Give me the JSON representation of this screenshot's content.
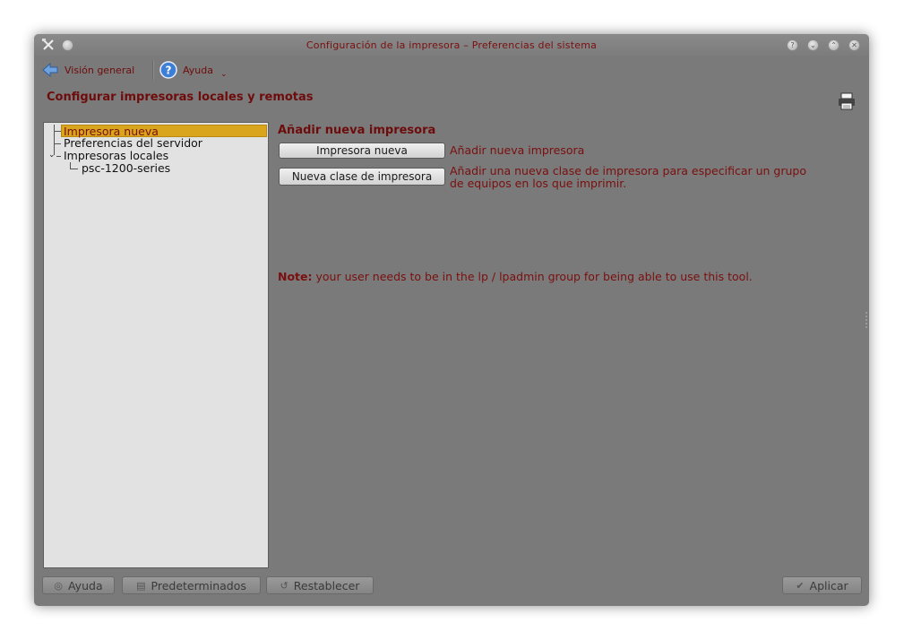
{
  "window": {
    "title": "Configuración de la impresora – Preferencias del sistema",
    "accent_color": "#7a0f0f",
    "background_color": "#7a7a7a"
  },
  "titlebar": {
    "buttons": [
      "help-icon",
      "minimize-icon",
      "maximize-icon",
      "close-icon"
    ]
  },
  "toolbar": {
    "overview_label": "Visión general",
    "help_label": "Ayuda"
  },
  "page": {
    "title": "Configurar impresoras locales y remotas"
  },
  "tree": {
    "items": [
      {
        "label": "Impresora nueva",
        "selected": true
      },
      {
        "label": "Preferencias del servidor",
        "selected": false
      },
      {
        "label": "Impresoras locales",
        "expanded": true
      },
      {
        "label": "psc-1200-series",
        "selected": false
      }
    ],
    "selection_color": "#d9a51c"
  },
  "main": {
    "section_title": "Añadir nueva impresora",
    "actions": [
      {
        "button": "Impresora nueva",
        "description": "Añadir nueva impresora"
      },
      {
        "button": "Nueva clase de impresora",
        "description_line1": "Añadir una nueva clase de impresora para especificar un grupo",
        "description_line2": "de equipos en los que imprimir."
      }
    ],
    "note_label": "Note:",
    "note_text": " your user needs to be in the lp / lpadmin group for being able to use this tool."
  },
  "footer": {
    "help": "Ayuda",
    "defaults": "Predeterminados",
    "reset": "Restablecer",
    "apply": "Aplicar"
  }
}
